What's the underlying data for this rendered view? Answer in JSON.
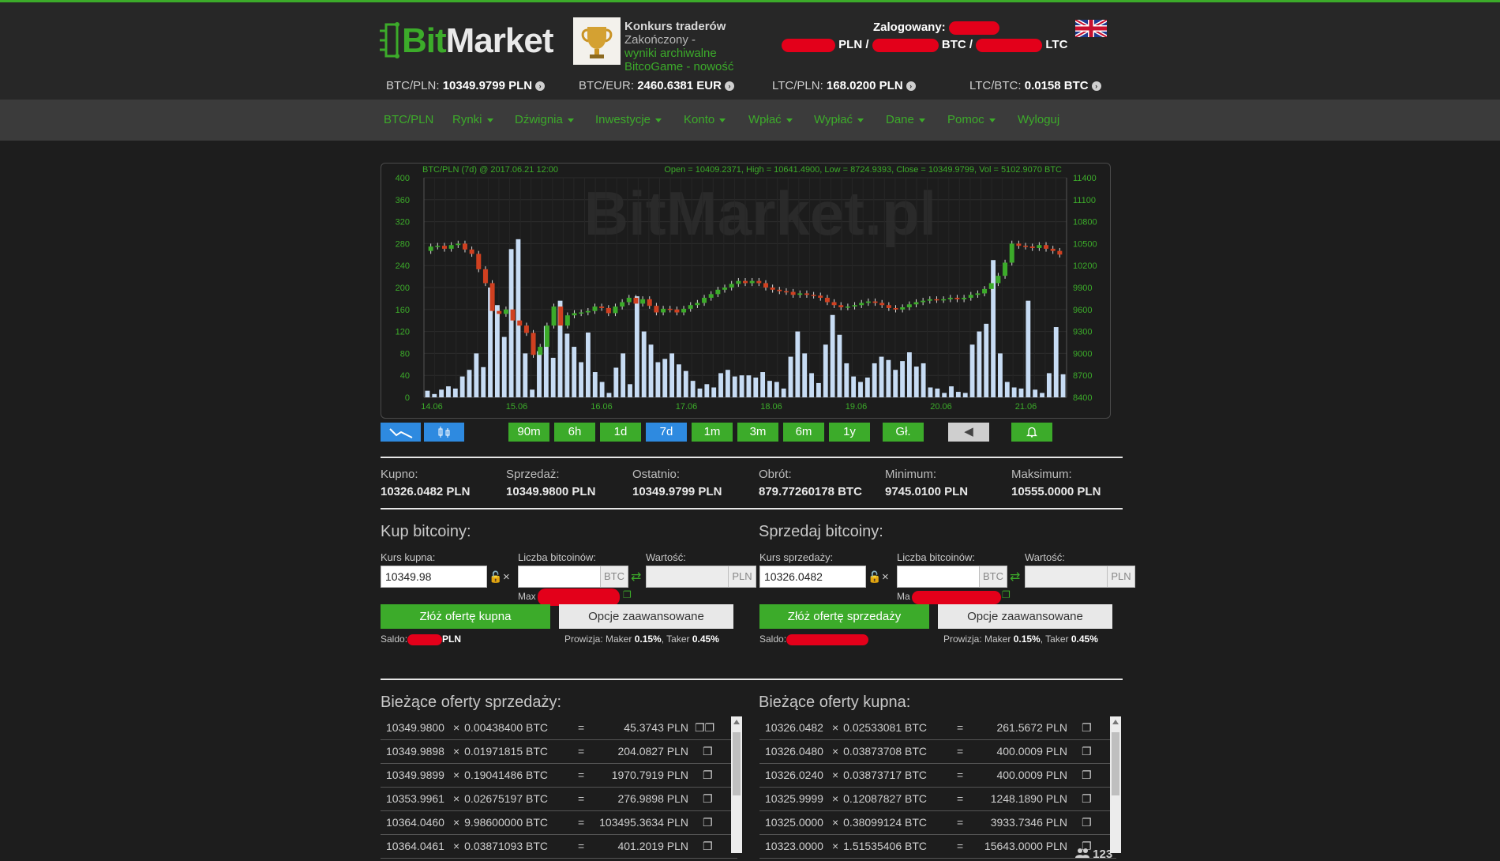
{
  "brand": {
    "part1": "Bit",
    "part2": "Market"
  },
  "contest": {
    "title": "Konkurs traderów",
    "status": "Zakończony -",
    "link1": "wyniki archiwalne",
    "link2": "BitcoGame - nowość"
  },
  "user": {
    "logged_label": "Zalogowany:",
    "pln": "PLN /",
    "btc": "BTC /",
    "ltc": "LTC"
  },
  "tickers": [
    {
      "label": "BTC/PLN:",
      "value": "10349.9799 PLN"
    },
    {
      "label": "BTC/EUR:",
      "value": "2460.6381 EUR"
    },
    {
      "label": "LTC/PLN:",
      "value": "168.0200 PLN"
    },
    {
      "label": "LTC/BTC:",
      "value": "0.0158 BTC"
    }
  ],
  "nav": [
    {
      "label": "BTC/PLN",
      "dropdown": false
    },
    {
      "label": "Rynki",
      "dropdown": true
    },
    {
      "label": "Dźwignia",
      "dropdown": true
    },
    {
      "label": "Inwestycje",
      "dropdown": true
    },
    {
      "label": "Konto",
      "dropdown": true
    },
    {
      "label": "Wpłać",
      "dropdown": true
    },
    {
      "label": "Wypłać",
      "dropdown": true
    },
    {
      "label": "Dane",
      "dropdown": true
    },
    {
      "label": "Pomoc",
      "dropdown": true
    },
    {
      "label": "Wyloguj",
      "dropdown": false
    }
  ],
  "chart_header": {
    "left": "BTC/PLN (7d) @ 2017.06.21 12:00",
    "right": "Open = 10409.2371, High = 10641.4900, Low = 8724.9393, Close = 10349.9799, Vol = 5102.9070 BTC"
  },
  "chart_data": {
    "type": "candlestick",
    "x_ticks": [
      "14.06",
      "15.06",
      "16.06",
      "17.06",
      "18.06",
      "19.06",
      "20.06",
      "21.06"
    ],
    "y_left_ticks": [
      0,
      40,
      80,
      120,
      160,
      200,
      240,
      280,
      320,
      360,
      400
    ],
    "y_right_ticks": [
      8400,
      8700,
      9000,
      9300,
      9600,
      9900,
      10200,
      10500,
      10800,
      11100,
      11400
    ],
    "volume_range": [
      0,
      400
    ],
    "price_range": [
      8400,
      11400
    ],
    "price_series": [
      10400,
      10460,
      10470,
      10430,
      10480,
      10500,
      10420,
      10360,
      10150,
      9960,
      9580,
      9540,
      9600,
      9450,
      9380,
      9280,
      8980,
      9090,
      9380,
      9640,
      9380,
      9520,
      9550,
      9560,
      9580,
      9640,
      9620,
      9550,
      9640,
      9700,
      9760,
      9680,
      9740,
      9650,
      9560,
      9610,
      9600,
      9560,
      9610,
      9660,
      9690,
      9760,
      9810,
      9870,
      9900,
      9950,
      9990,
      9960,
      9990,
      9960,
      9900,
      9870,
      9850,
      9840,
      9800,
      9820,
      9800,
      9790,
      9760,
      9700,
      9660,
      9630,
      9640,
      9660,
      9690,
      9710,
      9690,
      9660,
      9620,
      9600,
      9630,
      9670,
      9700,
      9720,
      9740,
      9730,
      9740,
      9760,
      9740,
      9760,
      9800,
      9820,
      9880,
      9960,
      10060,
      10240,
      10500,
      10470,
      10460,
      10440,
      10480,
      10430,
      10400,
      10350
    ],
    "volume_series": [
      12,
      6,
      14,
      20,
      16,
      38,
      50,
      80,
      55,
      200,
      168,
      110,
      270,
      288,
      80,
      14,
      84,
      130,
      72,
      176,
      116,
      92,
      64,
      118,
      46,
      28,
      8,
      54,
      80,
      24,
      184,
      120,
      96,
      64,
      70,
      80,
      60,
      48,
      30,
      16,
      24,
      18,
      44,
      50,
      38,
      40,
      40,
      36,
      46,
      30,
      28,
      16,
      74,
      120,
      80,
      44,
      26,
      96,
      150,
      114,
      62,
      38,
      28,
      36,
      62,
      74,
      68,
      50,
      66,
      82,
      56,
      62,
      18,
      16,
      8,
      20,
      10,
      8,
      96,
      120,
      134,
      250,
      80,
      28,
      18,
      16,
      176,
      14,
      8,
      44,
      128,
      42
    ]
  },
  "range_buttons": [
    "90m",
    "6h",
    "1d",
    "7d",
    "1m",
    "3m",
    "6m",
    "1y",
    "Gł."
  ],
  "active_range": "7d",
  "online_users": "123",
  "stats": [
    {
      "label": "Kupno:",
      "value": "10326.0482 PLN"
    },
    {
      "label": "Sprzedaż:",
      "value": "10349.9800 PLN"
    },
    {
      "label": "Ostatnio:",
      "value": "10349.9799 PLN"
    },
    {
      "label": "Obrót:",
      "value": "879.77260178 BTC"
    },
    {
      "label": "Minimum:",
      "value": "9745.0100 PLN"
    },
    {
      "label": "Maksimum:",
      "value": "10555.0000 PLN"
    }
  ],
  "buy": {
    "title": "Kup bitcoiny:",
    "rate_label": "Kurs kupna:",
    "rate_value": "10349.98",
    "amount_label": "Liczba bitcoinów:",
    "amount_unit": "BTC",
    "value_label": "Wartość:",
    "value_unit": "PLN",
    "max_label": "Max",
    "submit": "Złóż ofertę kupna",
    "advanced": "Opcje zaawansowane",
    "saldo_label": "Saldo:",
    "saldo_unit": "PLN",
    "fee_prefix": "Prowizja: Maker",
    "maker": "0.15%",
    "fee_mid": ", Taker",
    "taker": "0.45%"
  },
  "sell": {
    "title": "Sprzedaj bitcoiny:",
    "rate_label": "Kurs sprzedaży:",
    "rate_value": "10326.0482",
    "amount_label": "Liczba bitcoinów:",
    "amount_unit": "BTC",
    "value_label": "Wartość:",
    "value_unit": "PLN",
    "max_label": "Ma",
    "submit": "Złóż ofertę sprzedaży",
    "advanced": "Opcje zaawansowane",
    "saldo_label": "Saldo:",
    "fee_prefix": "Prowizja: Maker",
    "maker": "0.15%",
    "fee_mid": ", Taker",
    "taker": "0.45%"
  },
  "sell_offers": {
    "title": "Bieżące oferty sprzedaży:",
    "rows": [
      {
        "price": "10349.9800",
        "amount": "0.00438400 BTC",
        "value": "45.3743 PLN"
      },
      {
        "price": "10349.9898",
        "amount": "0.01971815 BTC",
        "value": "204.0827 PLN"
      },
      {
        "price": "10349.9899",
        "amount": "0.19041486 BTC",
        "value": "1970.7919 PLN"
      },
      {
        "price": "10353.9961",
        "amount": "0.02675197 BTC",
        "value": "276.9898 PLN"
      },
      {
        "price": "10364.0460",
        "amount": "9.98600000 BTC",
        "value": "103495.3634 PLN"
      },
      {
        "price": "10364.0461",
        "amount": "0.03871093 BTC",
        "value": "401.2019 PLN"
      }
    ]
  },
  "buy_offers": {
    "title": "Bieżące oferty kupna:",
    "rows": [
      {
        "price": "10326.0482",
        "amount": "0.02533081 BTC",
        "value": "261.5672 PLN"
      },
      {
        "price": "10326.0480",
        "amount": "0.03873708 BTC",
        "value": "400.0009 PLN"
      },
      {
        "price": "10326.0240",
        "amount": "0.03873717 BTC",
        "value": "400.0009 PLN"
      },
      {
        "price": "10325.9999",
        "amount": "0.12087827 BTC",
        "value": "1248.1890 PLN"
      },
      {
        "price": "10325.0000",
        "amount": "0.38099124 BTC",
        "value": "3933.7346 PLN"
      },
      {
        "price": "10323.0000",
        "amount": "1.51535406 BTC",
        "value": "15643.0000 PLN"
      }
    ]
  },
  "colors": {
    "accent": "#3cab2a",
    "blue": "#2e8ae0",
    "up": "#3cab2a",
    "down": "#d04020",
    "volume": "#c7dcf4"
  }
}
